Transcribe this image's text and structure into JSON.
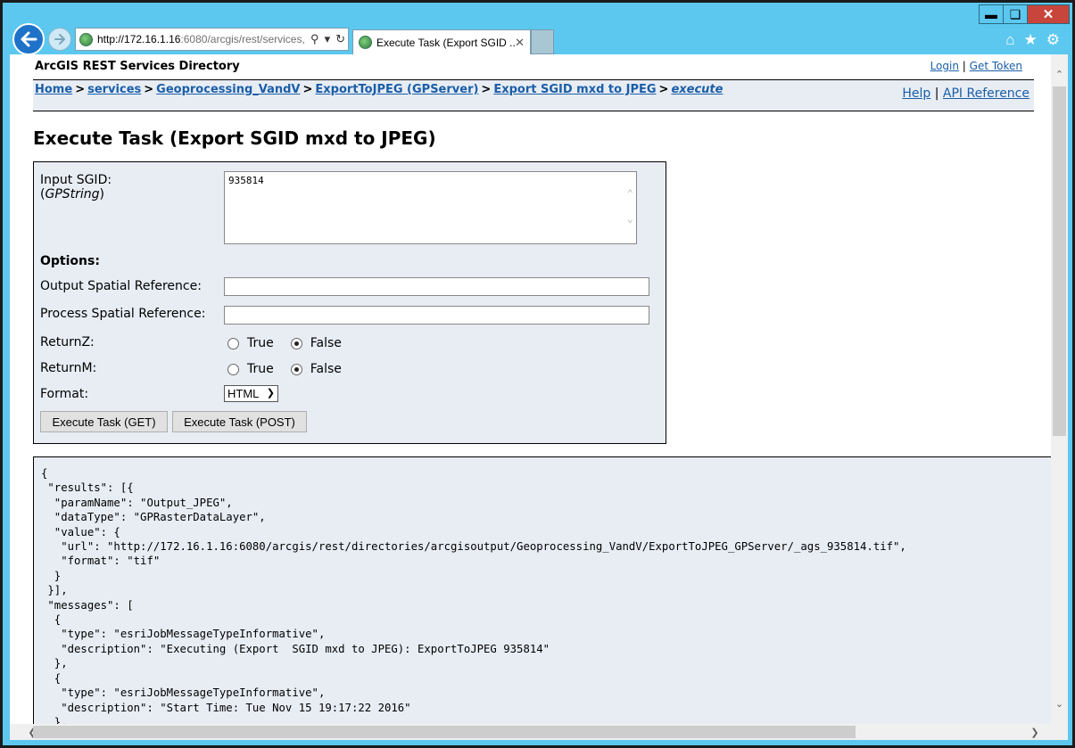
{
  "browser": {
    "address_host": "http://172.16.1.16",
    "address_rest": ":6080/arcgis/rest/services,",
    "tab_title": "Execute Task (Export SGID ...",
    "window_controls": [
      "minimize-icon",
      "restore-icon",
      "close-icon"
    ],
    "toolbar_icons": [
      "home-icon",
      "star-icon",
      "gear-icon"
    ]
  },
  "header": {
    "site_title": "ArcGIS REST Services Directory",
    "login": "Login",
    "get_token": "Get Token",
    "link_separator": "|",
    "help": "Help",
    "api_reference": "API Reference"
  },
  "breadcrumb": {
    "home": "Home",
    "services": "services",
    "folder": "Geoprocessing_VandV",
    "server": "ExportToJPEG (GPServer)",
    "task": "Export SGID mxd to JPEG",
    "current": "execute",
    "separator": ">"
  },
  "page": {
    "title": "Execute Task (Export SGID mxd to JPEG)"
  },
  "form": {
    "input_label": "Input SGID:",
    "input_type_open": "(",
    "input_type": "GPString",
    "input_type_close": ")",
    "input_value": "935814",
    "options_label": "Options:",
    "out_sr_label": "Output Spatial Reference:",
    "out_sr_value": "",
    "proc_sr_label": "Process Spatial Reference:",
    "proc_sr_value": "",
    "returnz_label": "ReturnZ:",
    "returnm_label": "ReturnM:",
    "true_label": "True",
    "false_label": "False",
    "returnz_selected": "False",
    "returnm_selected": "False",
    "format_label": "Format:",
    "format_selected": "HTML",
    "btn_get": "Execute Task (GET)",
    "btn_post": "Execute Task (POST)"
  },
  "result": {
    "json_text": "{\n \"results\": [{\n  \"paramName\": \"Output_JPEG\",\n  \"dataType\": \"GPRasterDataLayer\",\n  \"value\": {\n   \"url\": \"http://172.16.1.16:6080/arcgis/rest/directories/arcgisoutput/Geoprocessing_VandV/ExportToJPEG_GPServer/_ags_935814.tif\",\n   \"format\": \"tif\"\n  }\n }],\n \"messages\": [\n  {\n   \"type\": \"esriJobMessageTypeInformative\",\n   \"description\": \"Executing (Export  SGID mxd to JPEG): ExportToJPEG 935814\"\n  },\n  {\n   \"type\": \"esriJobMessageTypeInformative\",\n   \"description\": \"Start Time: Tue Nov 15 19:17:22 2016\"\n  },"
  }
}
